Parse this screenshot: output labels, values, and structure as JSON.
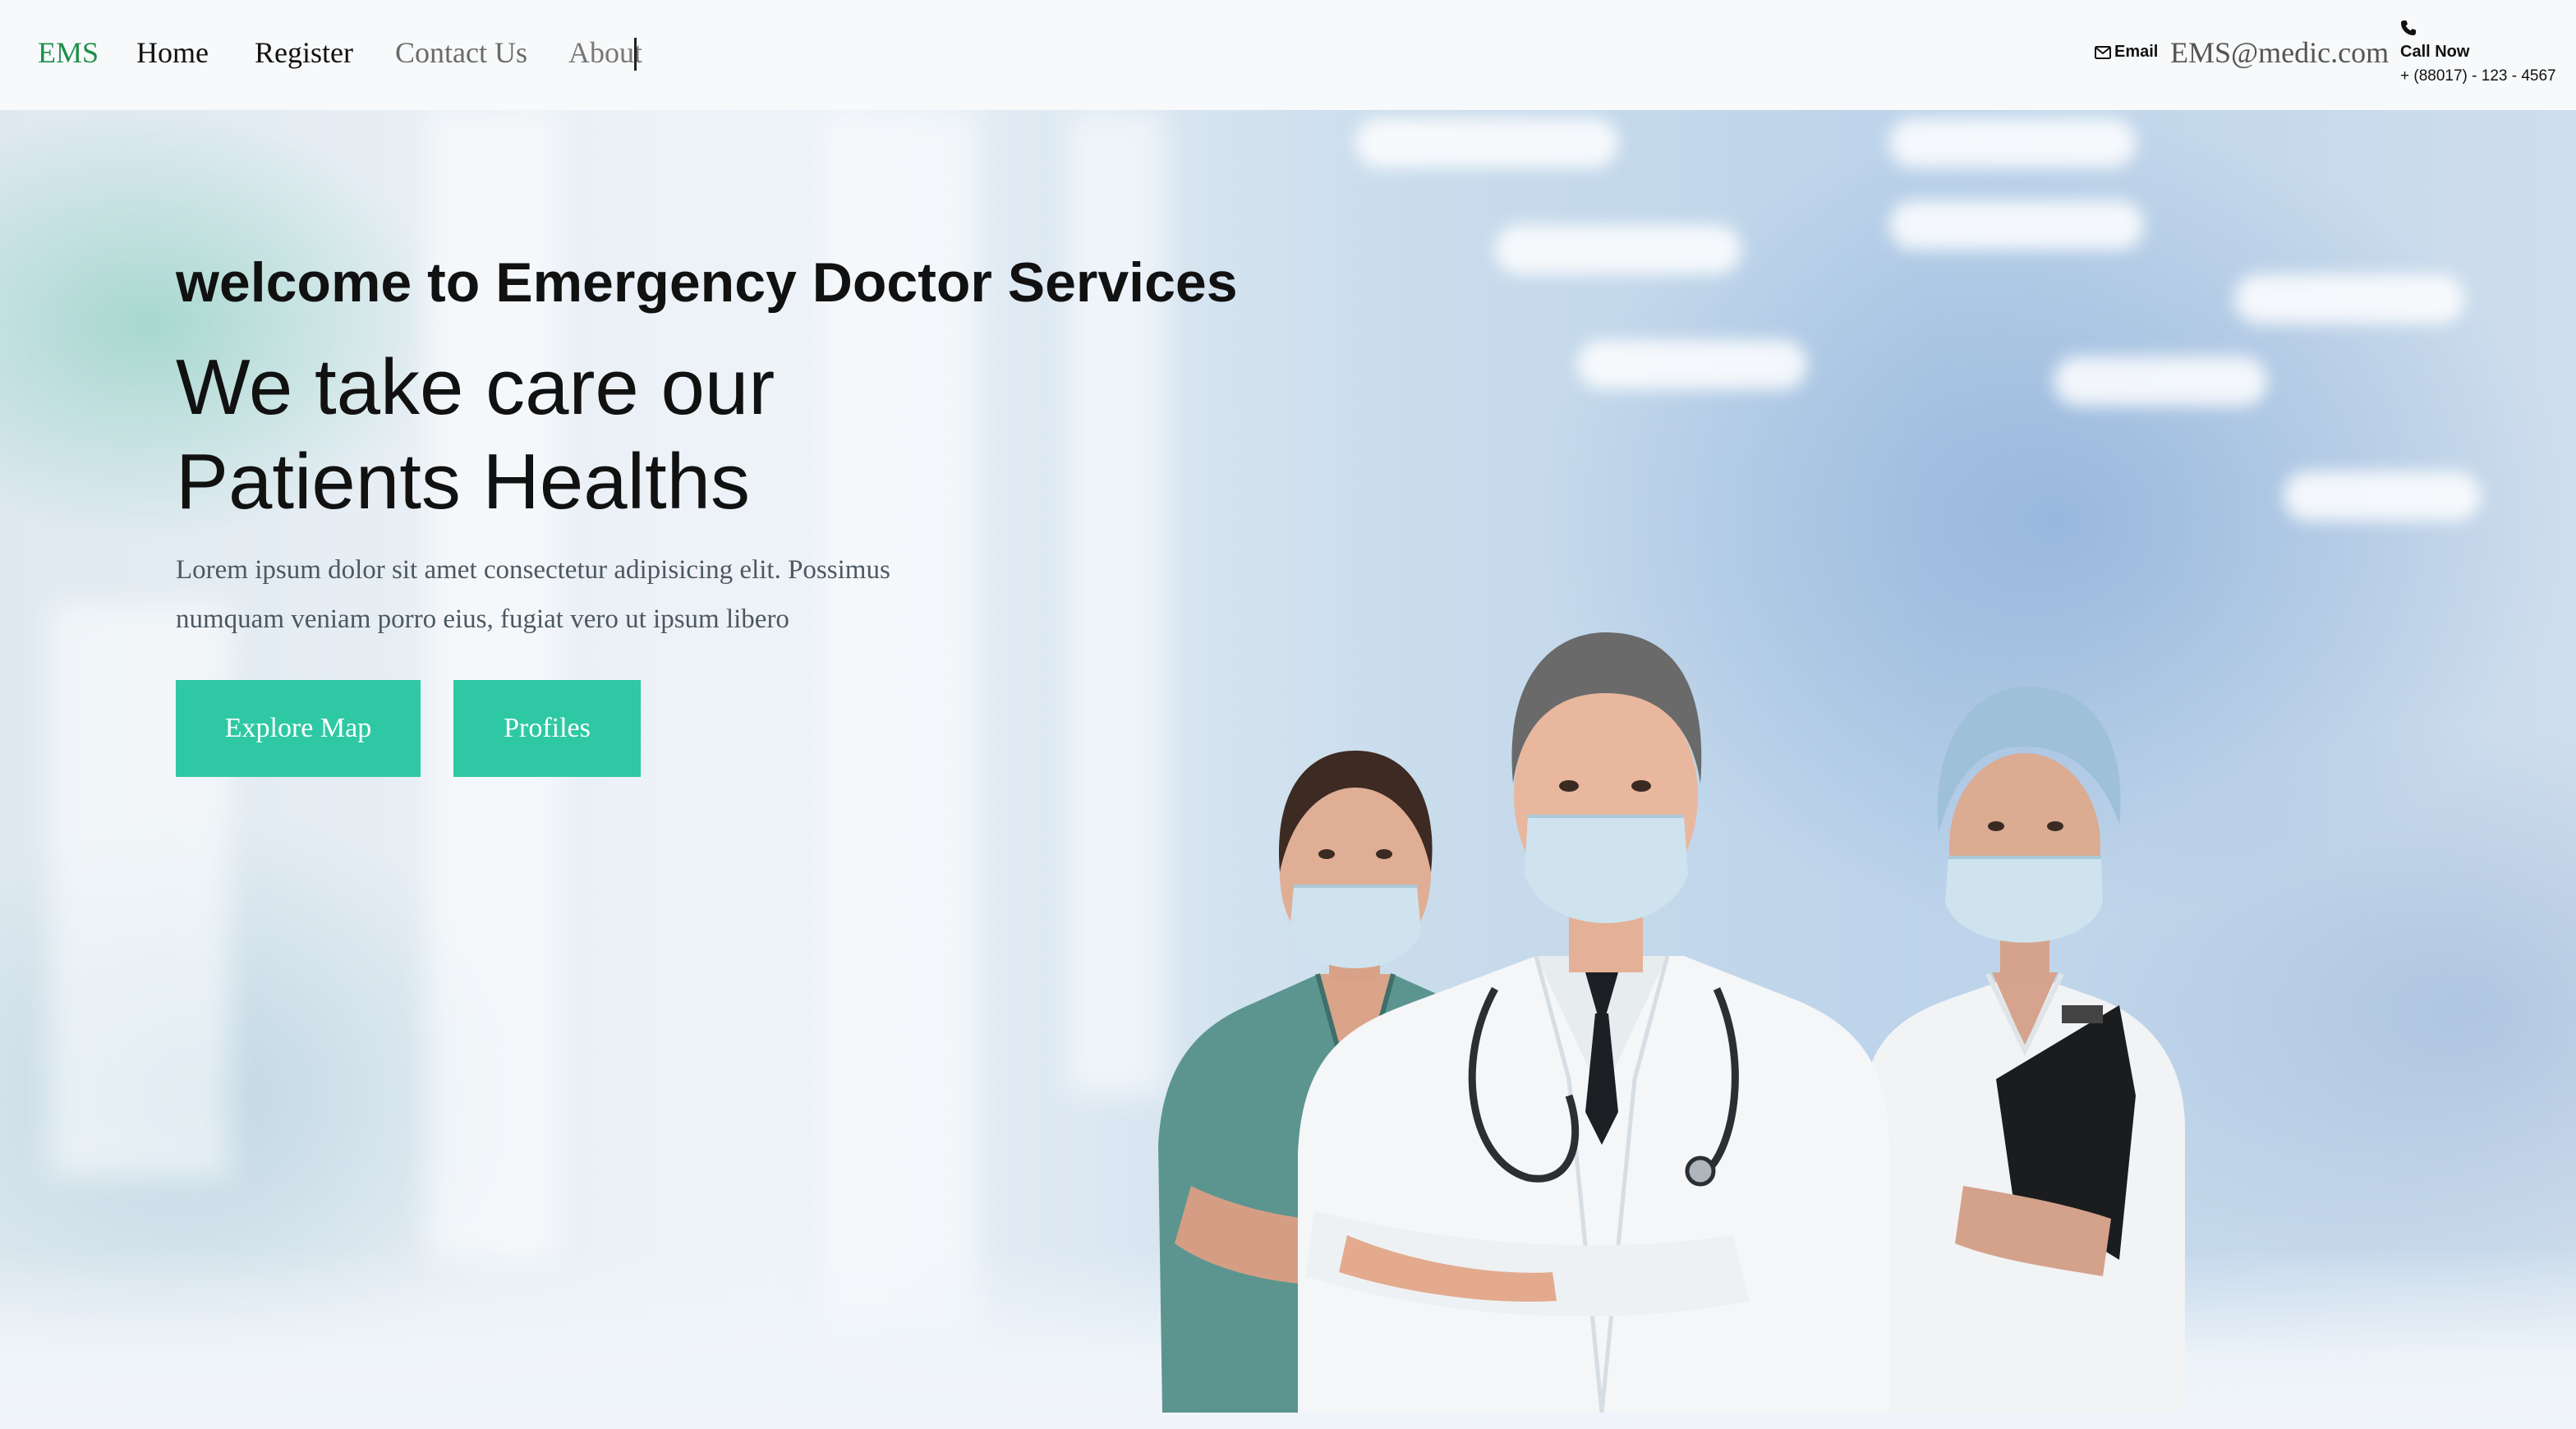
{
  "nav": {
    "brand": "EMS",
    "links": [
      {
        "label": "Home"
      },
      {
        "label": "Register"
      },
      {
        "label": "Contact Us"
      },
      {
        "label": "About"
      }
    ],
    "email_label": "Email",
    "email_value": "EMS@medic.com",
    "call_label": "Call Now",
    "call_number": "+ (88017) - 123 - 4567"
  },
  "hero": {
    "subtitle": "welcome to Emergency Doctor Services",
    "title_line1": "We take care our",
    "title_line2": "Patients Healths",
    "description": "Lorem ipsum dolor sit amet consectetur adipisicing elit. Possimus numquam veniam porro eius, fugiat vero ut ipsum libero",
    "buttons": [
      {
        "label": "Explore Map"
      },
      {
        "label": "Profiles"
      }
    ]
  },
  "colors": {
    "brand": "#1f8f4a",
    "button": "#2ec9a4",
    "scrub_green": "#5c9590",
    "coat_white": "#f4f6f8"
  },
  "icons": [
    "envelope-icon",
    "phone-icon"
  ]
}
